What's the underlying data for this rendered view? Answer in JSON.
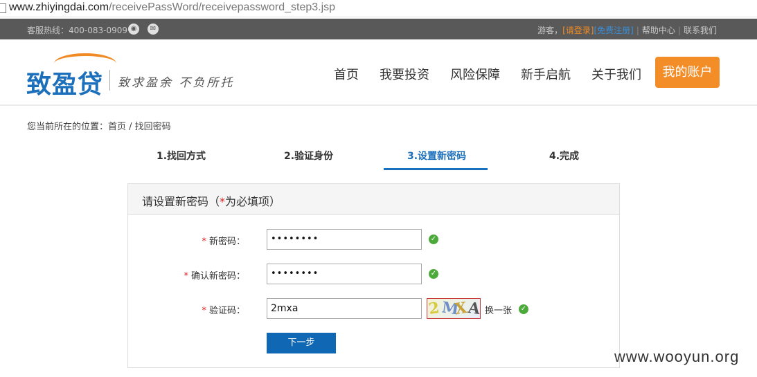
{
  "browser": {
    "url_host": "www.zhiyingdai.com",
    "url_path": "/receivePassWord/receivepassword_step3.jsp"
  },
  "topbar": {
    "hotline": "客服热线：400-083-0909",
    "icons": [
      "weibo-icon",
      "wechat-icon"
    ],
    "guest": "游客，",
    "login": "[请登录]",
    "register": "[免费注册]",
    "help": "帮助中心",
    "contact": "联系我们",
    "separator": "|"
  },
  "header": {
    "logo_name": "致盈贷",
    "slogan": "致求盈余 不负所托",
    "nav": [
      "首页",
      "我要投资",
      "风险保障",
      "新手启航",
      "关于我们"
    ],
    "account_button": "我的账户"
  },
  "breadcrumb": "您当前所在的位置：首页 / 找回密码",
  "steps": [
    {
      "label": "1.找回方式",
      "active": false
    },
    {
      "label": "2.验证身份",
      "active": false
    },
    {
      "label": "3.设置新密码",
      "active": true
    },
    {
      "label": "4.完成",
      "active": false
    }
  ],
  "form": {
    "title_prefix": "请设置新密码（",
    "title_required_mark": "*",
    "title_suffix": "为必填项）",
    "required_mark": "*",
    "new_password_label": "新密码：",
    "new_password_value": "••••••••",
    "confirm_password_label": "确认新密码：",
    "confirm_password_value": "••••••••",
    "captcha_label": "验证码：",
    "captcha_value": "2mxa",
    "captcha_image_text": "2MXA",
    "refresh_label": "换一张",
    "next_button": "下一步"
  },
  "watermark": "www.wooyun.org",
  "colors": {
    "brand_blue": "#1c6fba",
    "accent_orange": "#f28d28",
    "topbar_bg": "#595959",
    "success_green": "#4caa3a",
    "button_blue": "#1067b3"
  }
}
